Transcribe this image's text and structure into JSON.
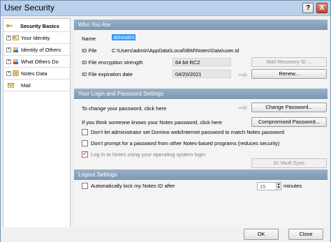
{
  "window": {
    "title": "User Security",
    "help_glyph": "?",
    "close_glyph": "X"
  },
  "sidebar": {
    "items": [
      {
        "label": "Security Basics",
        "icon": "key-icon"
      },
      {
        "label": "Your Identity",
        "icon": "id-card-icon"
      },
      {
        "label": "Identity of Others",
        "icon": "people-icon"
      },
      {
        "label": "What Others Do",
        "icon": "people-icon"
      },
      {
        "label": "Notes Data",
        "icon": "notes-icon"
      },
      {
        "label": "Mail",
        "icon": "mail-icon"
      }
    ]
  },
  "who_you_are": {
    "heading": "Who You Are",
    "name_label": "Name",
    "name_value": "abhi/abhi",
    "id_file_label": "ID File",
    "id_file_value": "C:\\Users\\admin\\AppData\\Local\\IBM\\Notes\\Data\\user.id",
    "encryption_label": "ID File encryption strength",
    "encryption_value": "64 bit RC2",
    "mail_recovery_button": "Mail Recovery ID ...",
    "expiration_label": "ID File expiration date",
    "expiration_value": "04/20/2021",
    "renew_button": "Renew..."
  },
  "login_password": {
    "heading": "Your Login and Password Settings",
    "change_text": "To change your password, click here",
    "change_button": "Change Password...",
    "compromised_text": "If you think someone knows your Notes password, click here",
    "compromised_button": "Compromised Password...",
    "opt_domino": "Don't let administrator set Domino web/Internet password to match Notes password",
    "opt_prompt": "Don't prompt for a password from other Notes-based programs (reduces security)",
    "opt_os_login": "Log in to Notes using your operating system login",
    "vault_button": "ID Vault Sync"
  },
  "logout": {
    "heading": "Logout Settings",
    "auto_lock_label": "Automatically lock my Notes ID after",
    "minutes_value": "15",
    "minutes_label": "minutes"
  },
  "footer": {
    "ok": "OK",
    "close": "Close"
  },
  "colors": {
    "section_header": "#8aa3bd",
    "selection": "#3399ff",
    "checkbox_highlight": "#d9534f"
  }
}
